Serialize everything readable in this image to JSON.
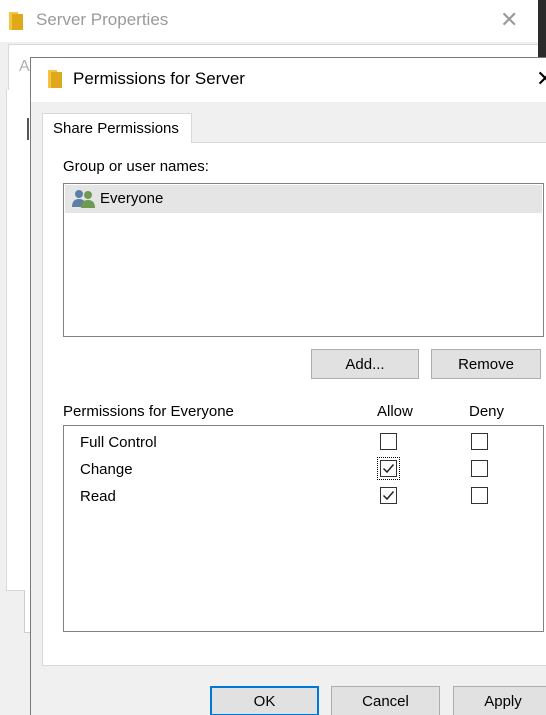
{
  "background_window": {
    "title": "Server Properties",
    "tab_partial": "A",
    "close_glyph": "✕"
  },
  "dialog": {
    "title": "Permissions for Server",
    "close_glyph": "✕",
    "tab_label": "Share Permissions",
    "group_label": "Group or user names:",
    "users": [
      {
        "name": "Everyone",
        "icon": "users-group-icon",
        "selected": true
      }
    ],
    "add_label": "Add...",
    "remove_label": "Remove",
    "permissions_label": "Permissions for Everyone",
    "allow_header": "Allow",
    "deny_header": "Deny",
    "permissions": [
      {
        "name": "Full Control",
        "allow": false,
        "deny": false
      },
      {
        "name": "Change",
        "allow": true,
        "deny": false
      },
      {
        "name": "Read",
        "allow": true,
        "deny": false
      }
    ],
    "ok_label": "OK",
    "cancel_label": "Cancel",
    "apply_label": "Apply"
  },
  "colors": {
    "folder": "#f4c542",
    "default_button_border": "#0078d7",
    "selection": "#e5e5e5"
  }
}
